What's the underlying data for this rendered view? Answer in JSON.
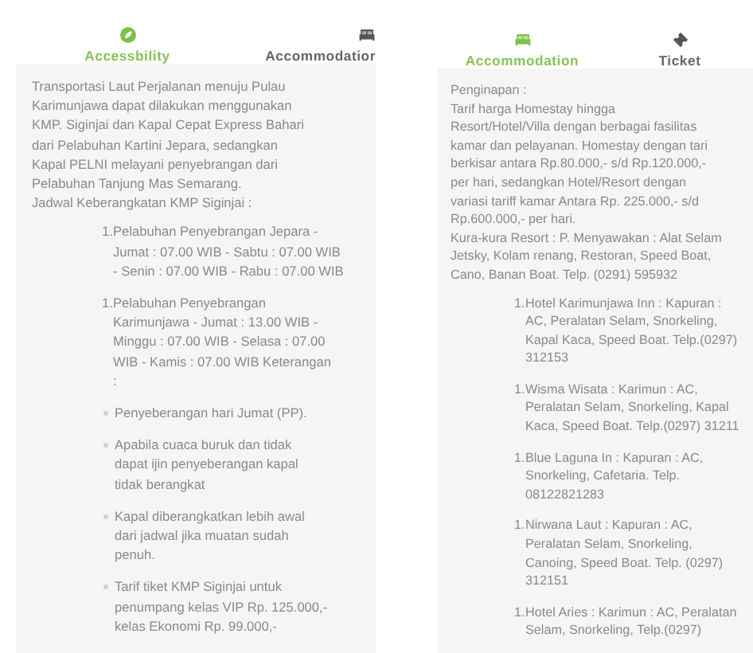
{
  "panels": [
    {
      "tabs": [
        {
          "label": "Accessbility",
          "selected": true,
          "kind": "leaf"
        },
        {
          "label": "Accommodatior",
          "selected": false,
          "kind": "bed"
        }
      ],
      "intro": [
        "Transportasi Laut Perjalanan menuju Pulau",
        "Karimunjawa dapat dilakukan menggunakan",
        "KMP. Siginjai dan Kapal Cepat Express Bahari",
        "dari Pelabuhan Kartini Jepara, sedangkan",
        "Kapal PELNI melayani penyebrangan dari",
        "Pelabuhan Tanjung Mas Semarang.",
        "Jadwal Keberangkatan KMP Siginjai :"
      ],
      "items": [
        {
          "kind": "numbered",
          "number": "1.",
          "lines": [
            "Pelabuhan Penyebrangan Jepara -",
            "Jumat : 07.00 WIB - Sabtu : 07.00 WIB",
            "- Senin : 07.00 WIB - Rabu : 07.00 WIB"
          ]
        },
        {
          "kind": "numbered",
          "number": "1.",
          "lines": [
            "Pelabuhan Penyebrangan",
            "Karimunjawa - Jumat : 13.00 WIB -",
            "Minggu : 07.00 WIB - Selasa : 07.00",
            "WIB - Kamis : 07.00 WIB Keterangan",
            ":"
          ]
        },
        {
          "kind": "bullet",
          "lines": [
            "Penyeberangan hari Jumat (PP)."
          ]
        },
        {
          "kind": "bullet",
          "lines": [
            "Apabila cuaca buruk dan tidak",
            "dapat ijin penyeberangan kapal",
            "tidak berangkat"
          ]
        },
        {
          "kind": "bullet",
          "lines": [
            "Kapal diberangkatkan lebih awal",
            "dari jadwal jika muatan sudah",
            "penuh."
          ]
        },
        {
          "kind": "bullet",
          "lines": [
            "Tarif tiket KMP Siginjai untuk",
            "penumpang kelas VIP Rp. 125.000,-",
            "kelas Ekonomi Rp. 99.000,-"
          ]
        }
      ]
    },
    {
      "tabs": [
        {
          "label": "Accommodation",
          "selected": true,
          "kind": "bed"
        },
        {
          "label": "Ticket",
          "selected": false,
          "kind": "ticket"
        }
      ],
      "intro": [
        "Penginapan :",
        "Tarif harga Homestay hingga",
        "Resort/Hotel/Villa dengan berbagai fasilitas",
        "kamar dan pelayanan. Homestay dengan tari",
        "berkisar antara Rp.80.000,- s/d Rp.120.000,-",
        "per hari, sedangkan Hotel/Resort dengan",
        "variasi tariff kamar Antara Rp. 225.000,- s/d",
        "Rp.600.000,- per hari.",
        "Kura-kura Resort : P. Menyawakan : Alat Selam",
        "Jetsky, Kolam renang, Restoran, Speed Boat,",
        "Cano, Banan Boat. Telp. (0291) 595932"
      ],
      "items": [
        {
          "kind": "numbered",
          "number": "1.",
          "lines": [
            "Hotel Karimunjawa Inn : Kapuran :",
            "AC, Peralatan Selam, Snorkeling,",
            "Kapal Kaca, Speed Boat. Telp.(0297)",
            "312153"
          ]
        },
        {
          "kind": "numbered",
          "number": "1.",
          "lines": [
            "Wisma Wisata : Karimun : AC,",
            "Peralatan Selam, Snorkeling, Kapal",
            "Kaca, Speed Boat. Telp.(0297) 31211"
          ]
        },
        {
          "kind": "numbered",
          "number": "1.",
          "lines": [
            "Blue Laguna In : Kapuran : AC,",
            "Snorkeling, Cafetaria. Telp.",
            "08122821283"
          ]
        },
        {
          "kind": "numbered",
          "number": "1.",
          "lines": [
            "Nirwana Laut : Kapuran : AC,",
            "Peralatan Selam, Snorkeling,",
            "Canoing, Speed Boat. Telp. (0297)",
            "312151"
          ]
        },
        {
          "kind": "numbered",
          "number": "1.",
          "lines": [
            "Hotel Aries : Karimun : AC, Peralatan",
            "Selam, Snorkeling, Telp.(0297)"
          ]
        }
      ]
    }
  ]
}
